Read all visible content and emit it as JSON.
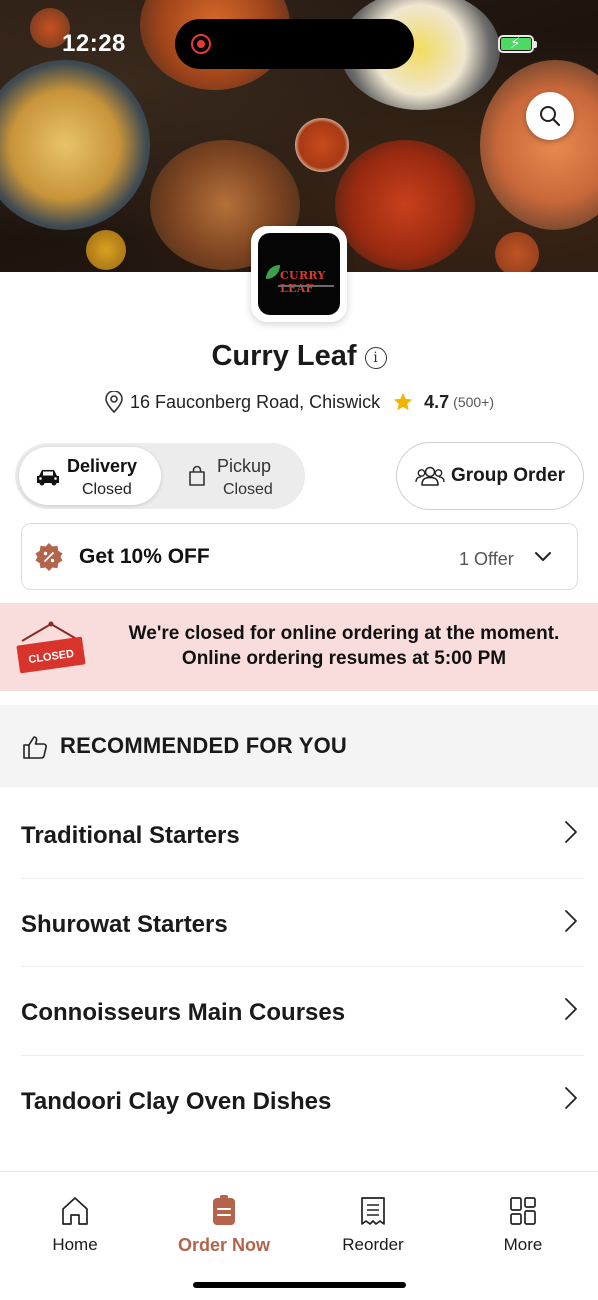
{
  "status_bar": {
    "time": "12:28"
  },
  "restaurant": {
    "name": "Curry Leaf",
    "logo_text": "CURRY LEAF",
    "address": "16 Fauconberg Road, Chiswick",
    "rating": "4.7",
    "rating_count": "(500+)"
  },
  "order_modes": {
    "delivery": {
      "label": "Delivery",
      "status": "Closed"
    },
    "pickup": {
      "label": "Pickup",
      "status": "Closed"
    }
  },
  "group_order_label": "Group Order",
  "offer": {
    "title": "Get 10% OFF",
    "count": "1 Offer"
  },
  "closed_banner": {
    "sign_text": "CLOSED",
    "line1": "We're closed for online ordering at the moment.",
    "line2": "Online ordering resumes at 5:00 PM"
  },
  "recommended": {
    "title": "RECOMMENDED FOR YOU"
  },
  "categories": [
    "Traditional Starters",
    "Shurowat Starters",
    "Connoisseurs Main Courses",
    "Tandoori Clay Oven Dishes"
  ],
  "bottom_nav": [
    {
      "label": "Home",
      "icon": "home-icon"
    },
    {
      "label": "Order Now",
      "icon": "order-icon",
      "active": true
    },
    {
      "label": "Reorder",
      "icon": "receipt-icon"
    },
    {
      "label": "More",
      "icon": "grid-icon"
    }
  ],
  "colors": {
    "accent": "#b4644a",
    "banner_bg": "#f9dcdc",
    "closed_red": "#d8342c",
    "star": "#f5b301"
  }
}
